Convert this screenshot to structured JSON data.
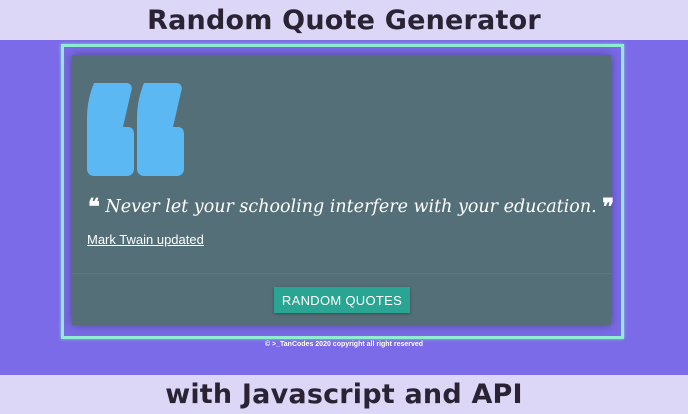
{
  "banner": {
    "title": "Random Quote Generator",
    "subtitle": "with Javascript and API"
  },
  "card": {
    "big_quote_icon": "quote-left-icon",
    "open_mark": "❝",
    "close_mark": "❞",
    "quote_text": "Never let your schooling interfere with your education.",
    "author": "Mark Twain updated",
    "button_label": "RANDOM QUOTES"
  },
  "footer": {
    "copyright": "© >_TanCodes 2020 copyright all right reserved"
  },
  "colors": {
    "background": "#7b6be8",
    "band": "#dcd6f7",
    "card": "#556f79",
    "frame": "#8ef0d0",
    "accent_icon": "#5bb8f2",
    "button": "#2aa594"
  }
}
